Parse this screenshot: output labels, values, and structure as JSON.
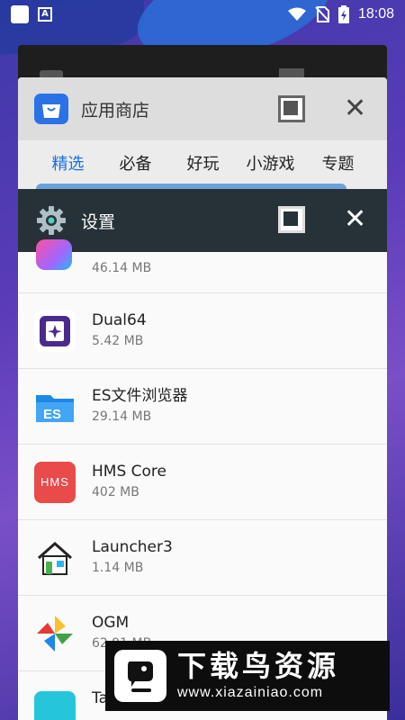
{
  "status_bar": {
    "time": "18:08",
    "icons": [
      "notification-square-icon",
      "a-notification-icon",
      "wifi-icon",
      "no-sim-icon",
      "battery-charging-icon"
    ]
  },
  "cards": {
    "app_store": {
      "title": "应用商店",
      "icon": "shopping-bag-icon",
      "accent": "#2a72e6",
      "tabs": [
        "精选",
        "必备",
        "好玩",
        "小游戏",
        "专题"
      ],
      "active_tab": "精选"
    },
    "settings": {
      "title": "设置",
      "icon": "gear-icon",
      "header_color": "#263238"
    }
  },
  "apps": [
    {
      "name": "",
      "size": "46.14 MB",
      "icon": "colorful-app-icon"
    },
    {
      "name": "Dual64",
      "size": "5.42 MB",
      "icon": "dual64-icon"
    },
    {
      "name": "ES文件浏览器",
      "size": "29.14 MB",
      "icon": "es-file-explorer-icon"
    },
    {
      "name": "HMS Core",
      "size": "402 MB",
      "icon": "hms-core-icon"
    },
    {
      "name": "Launcher3",
      "size": "1.14 MB",
      "icon": "launcher-house-icon"
    },
    {
      "name": "OGM",
      "size": "62.91 MB",
      "icon": "pinwheel-icon"
    },
    {
      "name": "Ta",
      "size": "",
      "icon": "teal-app-icon"
    }
  ],
  "watermark": {
    "title": "下载鸟资源",
    "url": "www.xiazainiao.com"
  }
}
